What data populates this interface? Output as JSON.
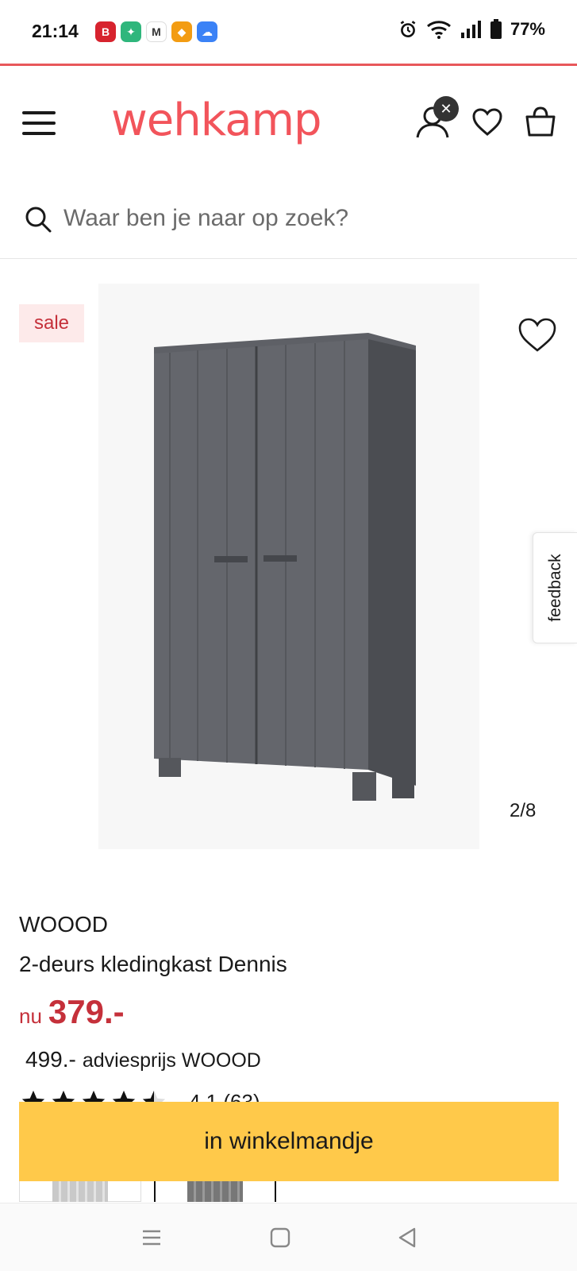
{
  "status_bar": {
    "time": "21:14",
    "battery": "77%",
    "app_badges": [
      {
        "label": "B",
        "color": "#d7232e",
        "name": "brave-app-icon"
      },
      {
        "label": "✦",
        "color": "#2fb67c",
        "name": "vpn-app-icon"
      },
      {
        "label": "M",
        "color": "#ffffff",
        "name": "gmail-app-icon"
      },
      {
        "label": "◆",
        "color": "#f39c12",
        "name": "shield-app-icon"
      },
      {
        "label": "☁",
        "color": "#3b82f6",
        "name": "weather-app-icon"
      }
    ]
  },
  "header": {
    "logo": "wehkamp",
    "brand_color": "#f2545b"
  },
  "search": {
    "placeholder": "Waar ben je naar op zoek?"
  },
  "gallery": {
    "sale_label": "sale",
    "counter": "2/8",
    "feedback_label": "feedback"
  },
  "product": {
    "brand": "WOOOD",
    "name": "2-deurs kledingkast Dennis",
    "price_prefix": "nu",
    "price": "379.-",
    "advice_price": "499.-",
    "advice_label": "adviesprijs WOOOD",
    "rating_value": 4.5,
    "rating_text": "4.1 (63)"
  },
  "cta": {
    "label": "in winkelmandje",
    "color": "#ffc94a"
  },
  "colors": {
    "accent": "#c5303a",
    "sale_bg": "#fdeaea"
  }
}
